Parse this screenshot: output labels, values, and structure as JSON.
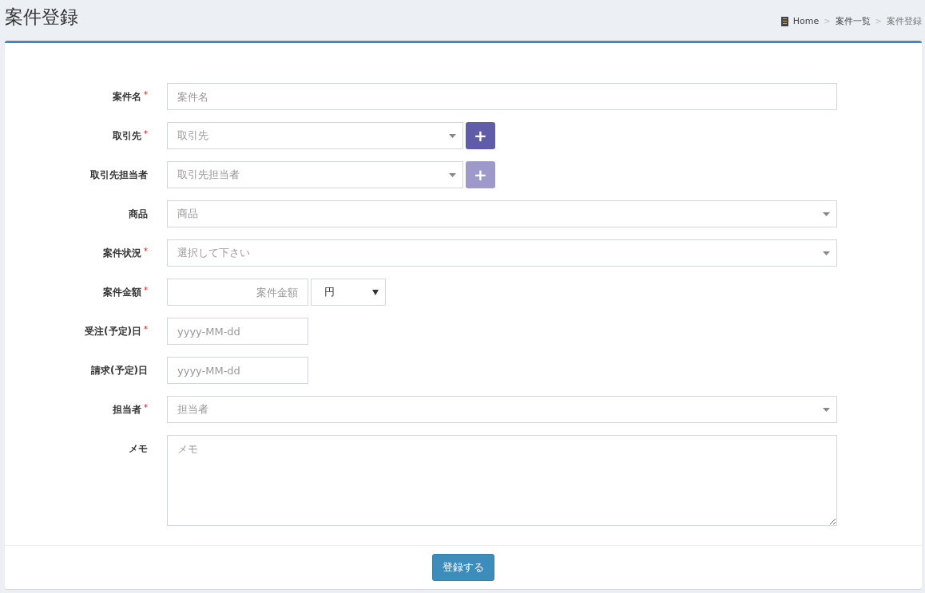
{
  "page_title": "案件登録",
  "breadcrumb": [
    {
      "label": "Home",
      "icon": true,
      "current": false
    },
    {
      "label": "案件一覧",
      "current": false
    },
    {
      "label": "案件登録",
      "current": true
    }
  ],
  "breadcrumb_separator": ">",
  "form": {
    "fields": [
      {
        "label": "案件名",
        "required": true,
        "kind": "text",
        "placeholder": "案件名"
      },
      {
        "label": "取引先",
        "required": true,
        "kind": "select-add",
        "placeholder": "取引先",
        "add_button": {
          "label": "+",
          "disabled": false
        }
      },
      {
        "label": "取引先担当者",
        "required": false,
        "kind": "select-add",
        "placeholder": "取引先担当者",
        "add_button": {
          "label": "+",
          "disabled": true
        }
      },
      {
        "label": "商品",
        "required": false,
        "kind": "select",
        "placeholder": "商品"
      },
      {
        "label": "案件状況",
        "required": true,
        "kind": "select",
        "placeholder": "選択して下さい"
      },
      {
        "label": "案件金額",
        "required": true,
        "kind": "amount",
        "placeholder": "案件金額",
        "currency": "円"
      },
      {
        "label": "受注(予定)日",
        "required": true,
        "kind": "date",
        "placeholder": "yyyy-MM-dd"
      },
      {
        "label": "請求(予定)日",
        "required": false,
        "kind": "date",
        "placeholder": "yyyy-MM-dd"
      },
      {
        "label": "担当者",
        "required": true,
        "kind": "select",
        "placeholder": "担当者"
      },
      {
        "label": "メモ",
        "required": false,
        "kind": "textarea",
        "placeholder": "メモ"
      }
    ],
    "required_mark": "*",
    "submit_button": "登録する"
  }
}
